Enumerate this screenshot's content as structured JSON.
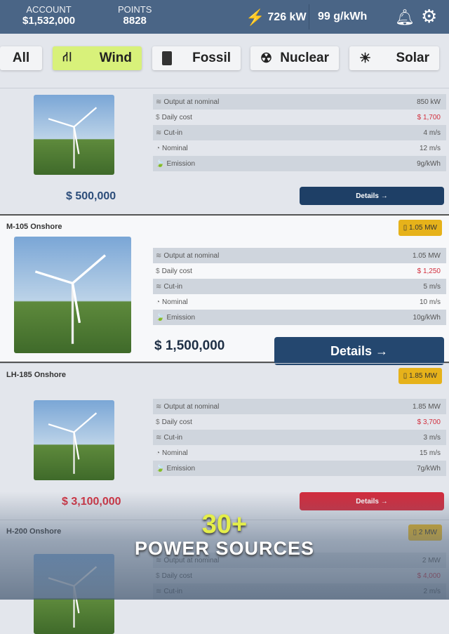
{
  "header": {
    "account_label": "ACCOUNT",
    "account_value": "$1,532,000",
    "points_label": "POINTS",
    "points_value": "8828",
    "power": "726 kW",
    "emission": "99 g/kWh"
  },
  "tabs": [
    {
      "label": "All",
      "icon": "none"
    },
    {
      "label": "Wind",
      "icon": "wind-turbine-icon",
      "active": true
    },
    {
      "label": "Fossil",
      "icon": "fuel-can-icon"
    },
    {
      "label": "Nuclear",
      "icon": "radiation-icon"
    },
    {
      "label": "Solar",
      "icon": "sun-icon"
    }
  ],
  "spec_labels": [
    "Output at nominal",
    "Daily cost",
    "Cut-in",
    "Nominal",
    "Emission"
  ],
  "cards": [
    {
      "name": "",
      "badge": "",
      "specs": [
        "850 kW",
        "$ 1,700",
        "4 m/s",
        "12 m/s",
        "9g/kWh"
      ],
      "price": "$ 500,000",
      "details": "Details →"
    },
    {
      "name": "M-105 Onshore",
      "badge": "1.05 MW",
      "specs": [
        "1.05 MW",
        "$ 1,250",
        "5 m/s",
        "10 m/s",
        "10g/kWh"
      ],
      "price": "$ 1,500,000",
      "details": "Details →"
    },
    {
      "name": "LH-185 Onshore",
      "badge": "1.85 MW",
      "specs": [
        "1.85 MW",
        "$ 3,700",
        "3 m/s",
        "15 m/s",
        "7g/kWh"
      ],
      "price": "$ 3,100,000",
      "details": "Details →"
    },
    {
      "name": "H-200 Onshore",
      "badge": "2 MW",
      "specs": [
        "2 MW",
        "$ 4,000",
        "2 m/s"
      ],
      "price": "",
      "details": ""
    }
  ],
  "promo": {
    "number": "30+",
    "text": "POWER SOURCES"
  },
  "colors": {
    "header": "#4a6586",
    "active_tab": "#d8f17a",
    "badge": "#e6b21a",
    "button": "#1e3f66",
    "danger": "#d22b3c"
  }
}
